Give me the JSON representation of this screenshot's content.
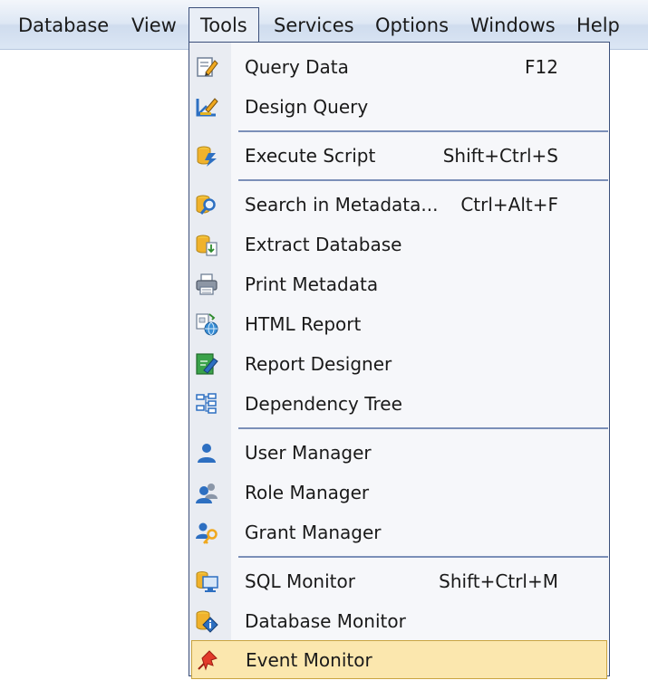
{
  "menubar": {
    "items": [
      {
        "label": "Database",
        "icon": ""
      },
      {
        "label": "View"
      },
      {
        "label": "Tools"
      },
      {
        "label": "Services"
      },
      {
        "label": "Options"
      },
      {
        "label": "Windows"
      },
      {
        "label": "Help"
      }
    ],
    "active": "Tools"
  },
  "dropdown": {
    "items": [
      {
        "label": "Query Data",
        "shortcut": "F12",
        "icon": "query-data-icon"
      },
      {
        "label": "Design Query",
        "shortcut": "",
        "icon": "design-query-icon"
      },
      {
        "label": "Execute Script",
        "shortcut": "Shift+Ctrl+S",
        "icon": "execute-script-icon"
      },
      {
        "label": "Search in Metadata...",
        "shortcut": "Ctrl+Alt+F",
        "icon": "search-metadata-icon"
      },
      {
        "label": "Extract Database",
        "shortcut": "",
        "icon": "extract-database-icon"
      },
      {
        "label": "Print Metadata",
        "shortcut": "",
        "icon": "printer-icon"
      },
      {
        "label": "HTML Report",
        "shortcut": "",
        "icon": "html-report-icon"
      },
      {
        "label": "Report Designer",
        "shortcut": "",
        "icon": "report-designer-icon"
      },
      {
        "label": "Dependency Tree",
        "shortcut": "",
        "icon": "dependency-tree-icon"
      },
      {
        "label": "User Manager",
        "shortcut": "",
        "icon": "user-icon"
      },
      {
        "label": "Role Manager",
        "shortcut": "",
        "icon": "role-manager-icon"
      },
      {
        "label": "Grant Manager",
        "shortcut": "",
        "icon": "grant-manager-icon"
      },
      {
        "label": "SQL Monitor",
        "shortcut": "Shift+Ctrl+M",
        "icon": "sql-monitor-icon"
      },
      {
        "label": "Database Monitor",
        "shortcut": "",
        "icon": "database-monitor-icon"
      },
      {
        "label": "Event Monitor",
        "shortcut": "",
        "icon": "event-monitor-icon"
      }
    ],
    "highlighted": "Event Monitor"
  },
  "colors": {
    "menubar_bg": "#dbe6f4",
    "menu_border": "#3b4f7a",
    "highlight_bg": "#fbe7ae",
    "highlight_border": "#c9a440",
    "separator": "#7b8fb8"
  }
}
